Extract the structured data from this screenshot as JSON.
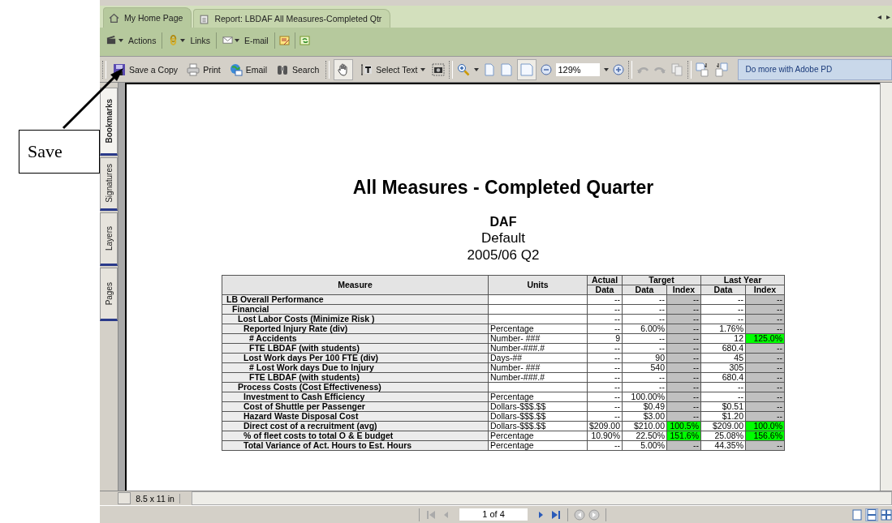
{
  "callout": {
    "label": "Save"
  },
  "tabs": [
    {
      "label": "My Home Page",
      "selected": true
    },
    {
      "label": "Report:  LBDAF  All Measures-Completed  Qtr",
      "selected": false
    }
  ],
  "tab_scroll": [
    "◂",
    "▸"
  ],
  "link_bar": [
    {
      "label": "Actions"
    },
    {
      "label": "Links"
    },
    {
      "label": "E-mail"
    }
  ],
  "toolbar": {
    "file_buttons": [
      {
        "label": "Save a Copy"
      },
      {
        "label": "Print"
      },
      {
        "label": "Email"
      },
      {
        "label": "Search"
      }
    ],
    "select_text": "Select Text",
    "zoom": "129%",
    "promo": "Do more with Adobe PD"
  },
  "side_tabs": [
    {
      "label": "Bookmarks",
      "selected": true
    },
    {
      "label": "Signatures",
      "selected": false
    },
    {
      "label": "Layers",
      "selected": false
    },
    {
      "label": "Pages",
      "selected": false
    }
  ],
  "report": {
    "title": "All Measures - Completed Quarter",
    "unit": "DAF",
    "scenario": "Default",
    "period": "2005/06 Q2",
    "columns": {
      "measure": "Measure",
      "units": "Units",
      "actual": "Actual",
      "target": "Target",
      "last_year": "Last Year",
      "actual_data": "Data",
      "target_data": "Data",
      "target_index": "Index",
      "last_year_data": "Data",
      "last_year_index": "Index"
    },
    "rows": [
      {
        "measure": "LB Overall Performance",
        "actual": "--",
        "target": "--",
        "target_index": {
          "text": "--",
          "highlight": false
        },
        "last_year": "--",
        "ly_index": {
          "text": "--",
          "highlight": false
        },
        "children": [
          {
            "measure": "Financial",
            "actual": "--",
            "target": "--",
            "target_index": {
              "text": "--",
              "highlight": false
            },
            "last_year": "--",
            "ly_index": {
              "text": "--",
              "highlight": false
            },
            "children": [
              {
                "measure": "Lost Labor Costs (Minimize Risk )",
                "actual": "--",
                "target": "--",
                "target_index": {
                  "text": "--",
                  "highlight": false
                },
                "last_year": "--",
                "ly_index": {
                  "text": "--",
                  "highlight": false
                },
                "children": [
                  {
                    "measure": "Reported Injury Rate (div)",
                    "units": "Percentage",
                    "actual": "--",
                    "target": "6.00%",
                    "target_index": {
                      "text": "--",
                      "highlight": false
                    },
                    "last_year": "1.76%",
                    "ly_index": {
                      "text": "--",
                      "highlight": false
                    },
                    "children": [
                      {
                        "measure": "# Accidents",
                        "units": "Number- ###",
                        "actual": "9",
                        "target": "--",
                        "target_index": {
                          "text": "--",
                          "highlight": false
                        },
                        "last_year": "12",
                        "ly_index": {
                          "text": "125.0%",
                          "highlight": true
                        }
                      },
                      {
                        "measure": "FTE LBDAF (with students)",
                        "units": "Number-###.#",
                        "actual": "--",
                        "target": "--",
                        "target_index": {
                          "text": "--",
                          "highlight": false
                        },
                        "last_year": "680.4",
                        "ly_index": {
                          "text": "--",
                          "highlight": false
                        }
                      }
                    ]
                  },
                  {
                    "measure": "Lost Work days Per 100 FTE (div)",
                    "units": "Days-##",
                    "actual": "--",
                    "target": "90",
                    "target_index": {
                      "text": "--",
                      "highlight": false
                    },
                    "last_year": "45",
                    "ly_index": {
                      "text": "--",
                      "highlight": false
                    },
                    "children": [
                      {
                        "measure": "# Lost Work days Due to Injury",
                        "units": "Number- ###",
                        "actual": "--",
                        "target": "540",
                        "target_index": {
                          "text": "--",
                          "highlight": false
                        },
                        "last_year": "305",
                        "ly_index": {
                          "text": "--",
                          "highlight": false
                        }
                      },
                      {
                        "measure": "FTE LBDAF (with students)",
                        "units": "Number-###.#",
                        "actual": "--",
                        "target": "--",
                        "target_index": {
                          "text": "--",
                          "highlight": false
                        },
                        "last_year": "680.4",
                        "ly_index": {
                          "text": "--",
                          "highlight": false
                        }
                      }
                    ]
                  }
                ]
              },
              {
                "measure": "Process Costs (Cost Effectiveness)",
                "actual": "--",
                "target": "--",
                "target_index": {
                  "text": "--",
                  "highlight": false
                },
                "last_year": "--",
                "ly_index": {
                  "text": "--",
                  "highlight": false
                },
                "children": [
                  {
                    "measure": "Investment to Cash Efficiency",
                    "units": "Percentage",
                    "actual": "--",
                    "target": "100.00%",
                    "target_index": {
                      "text": "--",
                      "highlight": false
                    },
                    "last_year": "--",
                    "ly_index": {
                      "text": "--",
                      "highlight": false
                    }
                  },
                  {
                    "measure": "Cost of Shuttle per Passenger",
                    "units": "Dollars-$$$.$$",
                    "actual": "--",
                    "target": "$0.49",
                    "target_index": {
                      "text": "--",
                      "highlight": false
                    },
                    "last_year": "$0.51",
                    "ly_index": {
                      "text": "--",
                      "highlight": false
                    }
                  },
                  {
                    "measure": "Hazard Waste Disposal Cost",
                    "units": "Dollars-$$$.$$",
                    "actual": "--",
                    "target": "$3.00",
                    "target_index": {
                      "text": "--",
                      "highlight": false
                    },
                    "last_year": "$1.20",
                    "ly_index": {
                      "text": "--",
                      "highlight": false
                    }
                  },
                  {
                    "measure": "Direct cost of a recruitment (avg)",
                    "units": "Dollars-$$$.$$",
                    "actual": "$209.00",
                    "target": "$210.00",
                    "target_index": {
                      "text": "100.5%",
                      "highlight": true
                    },
                    "last_year": "$209.00",
                    "ly_index": {
                      "text": "100.0%",
                      "highlight": true
                    }
                  },
                  {
                    "measure": "% of fleet costs to total O & E budget",
                    "units": "Percentage",
                    "actual": "10.90%",
                    "target": "22.50%",
                    "target_index": {
                      "text": "151.6%",
                      "highlight": true
                    },
                    "last_year": "25.08%",
                    "ly_index": {
                      "text": "156.6%",
                      "highlight": true
                    }
                  },
                  {
                    "measure": "Total Variance of Act. Hours to Est. Hours",
                    "units": "Percentage",
                    "actual": "--",
                    "target": "5.00%",
                    "target_index": {
                      "text": "--",
                      "highlight": false
                    },
                    "last_year": "44.35%",
                    "ly_index": {
                      "text": "--",
                      "highlight": false
                    }
                  }
                ]
              }
            ]
          }
        ]
      }
    ]
  },
  "page_size": "8.5 x 11 in",
  "status_bar": {
    "page": "1 of 4"
  }
}
